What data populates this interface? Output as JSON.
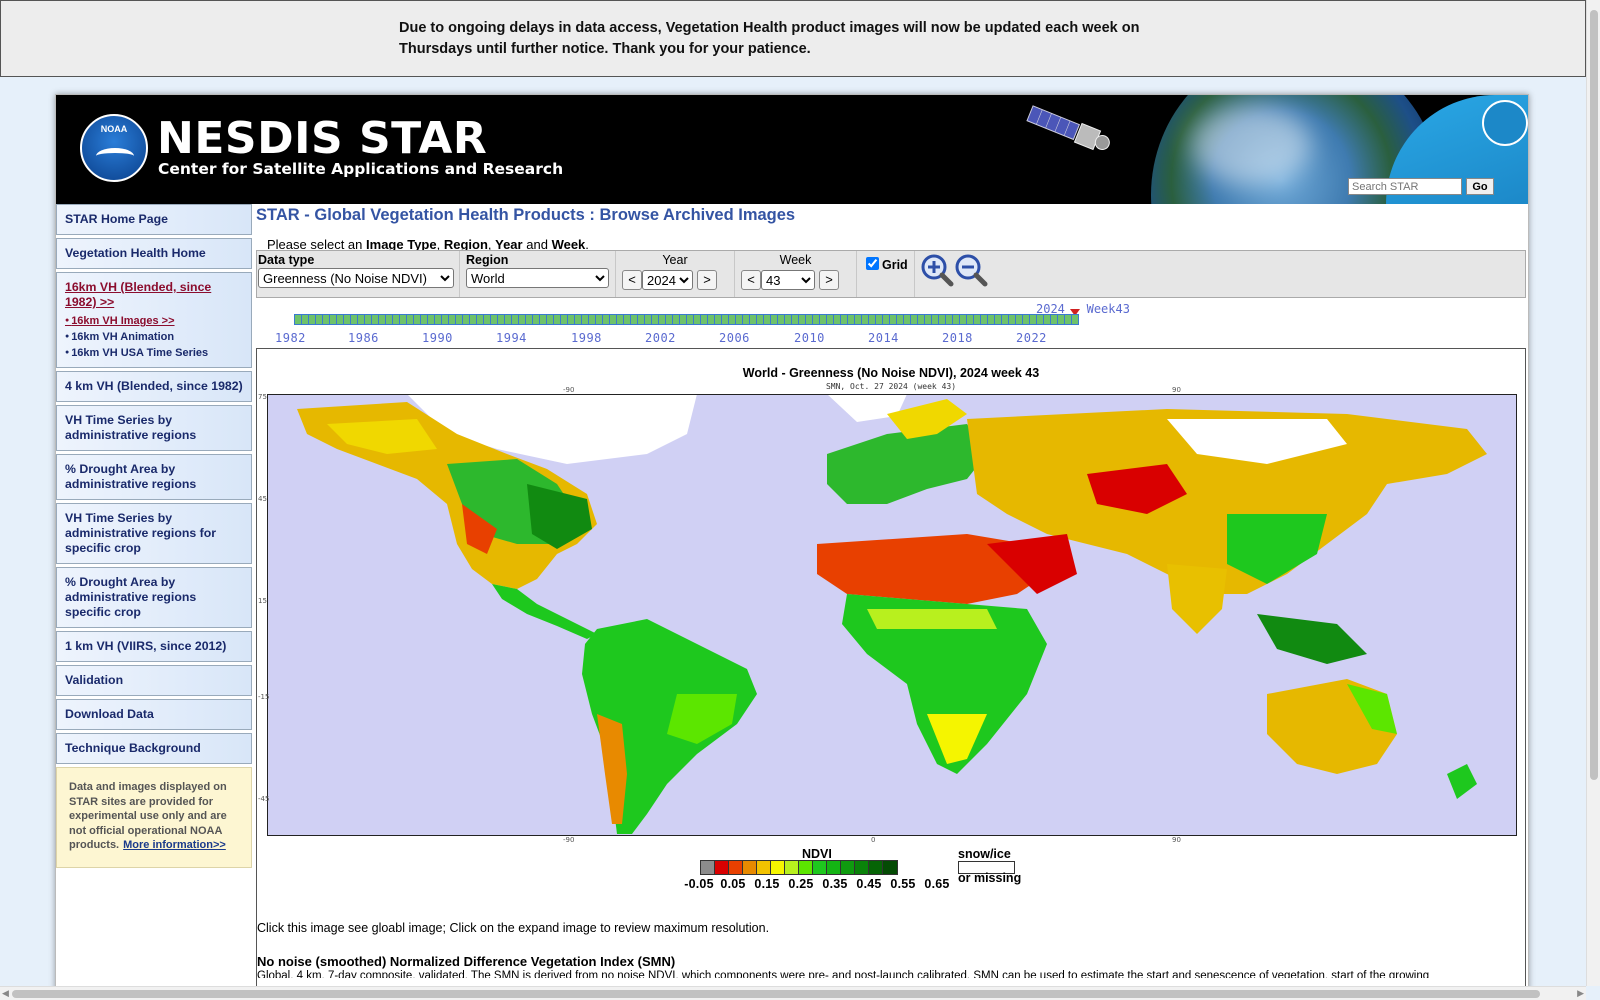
{
  "notice": {
    "text": "Due to ongoing delays in data access, Vegetation Health product images will now be updated each week on Thursdays until further notice. Thank you for your patience."
  },
  "header": {
    "logo_text": "NOAA",
    "brand": "NESDIS STAR",
    "subbrand": "Center for Satellite Applications and Research",
    "search_placeholder": "Search STAR",
    "go_label": "Go"
  },
  "sidebar": {
    "items": [
      {
        "label": "STAR Home Page"
      },
      {
        "label": "Vegetation Health Home"
      },
      {
        "label": "16km VH (Blended, since 1982) >>",
        "active": true,
        "subs": [
          "16km VH Images >>",
          "16km VH Animation",
          "16km VH USA Time Series"
        ]
      },
      {
        "label": "4 km VH (Blended, since 1982)"
      },
      {
        "label": "VH Time Series by administrative regions"
      },
      {
        "label": "% Drought Area by administrative regions"
      },
      {
        "label": "VH Time Series by administrative regions for specific crop"
      },
      {
        "label": "% Drought Area by administrative regions specific crop"
      },
      {
        "label": "1 km VH (VIIRS, since 2012)"
      },
      {
        "label": "Validation"
      },
      {
        "label": "Download Data"
      },
      {
        "label": "Technique Background"
      }
    ],
    "disclaimer": "Data and images displayed on STAR sites are provided for experimental use only and are not official operational NOAA products.",
    "disclaimer_link": "More information>>"
  },
  "main": {
    "title": "STAR - Global Vegetation Health Products : Browse Archived Images",
    "instruction_prefix": "Please select an",
    "instruction_b1": "Image Type",
    "instruction_b2": "Region",
    "instruction_b3": "Year",
    "instruction_and": "and",
    "instruction_b4": "Week"
  },
  "controls": {
    "datatype_label": "Data type",
    "datatype_value": "Greenness (No Noise NDVI)",
    "region_label": "Region",
    "region_value": "World",
    "year_label": "Year",
    "year_value": "2024",
    "week_label": "Week",
    "week_value": "43",
    "prev": "<",
    "next": ">",
    "grid_label": "Grid",
    "grid_checked": true
  },
  "timeline": {
    "years": [
      "1982",
      "1986",
      "1990",
      "1994",
      "1998",
      "2002",
      "2006",
      "2010",
      "2014",
      "2018",
      "2022"
    ],
    "current_year": "2024",
    "current_week": "Week43"
  },
  "figure": {
    "title": "World - Greenness (No Noise NDVI), 2024 week 43",
    "subtitle": "SMN,  Oct. 27 2024 (week 43)",
    "lon_labels": [
      "-90",
      "0",
      "90"
    ],
    "lat_labels": [
      "75",
      "45",
      "15",
      "-15",
      "-45"
    ],
    "legend_title": "NDVI",
    "legend_colors": [
      "#8c8c8c",
      "#d90000",
      "#e84000",
      "#e88a00",
      "#f2c200",
      "#f5f500",
      "#b8f01e",
      "#5ce600",
      "#1ec81e",
      "#14b414",
      "#0f9b0f",
      "#0a820a",
      "#066406",
      "#044b04"
    ],
    "legend_ticks": [
      "-0.05",
      "0.05",
      "0.15",
      "0.25",
      "0.35",
      "0.45",
      "0.55",
      "0.65"
    ],
    "snow_label": "snow/ice",
    "missing_label": "or missing"
  },
  "below": {
    "click_note": "Click this image see gloabl image; Click on the expand image to review maximum resolution.",
    "smn_heading": "No noise (smoothed) Normalized Difference Vegetation Index (SMN)",
    "smn_body": "Global, 4 km, 7-day composite, validated. The SMN is derived from no noise NDVI, which components were pre- and post-launch calibrated. SMN can be used to estimate the start and senescence of vegetation, start of the growing"
  }
}
